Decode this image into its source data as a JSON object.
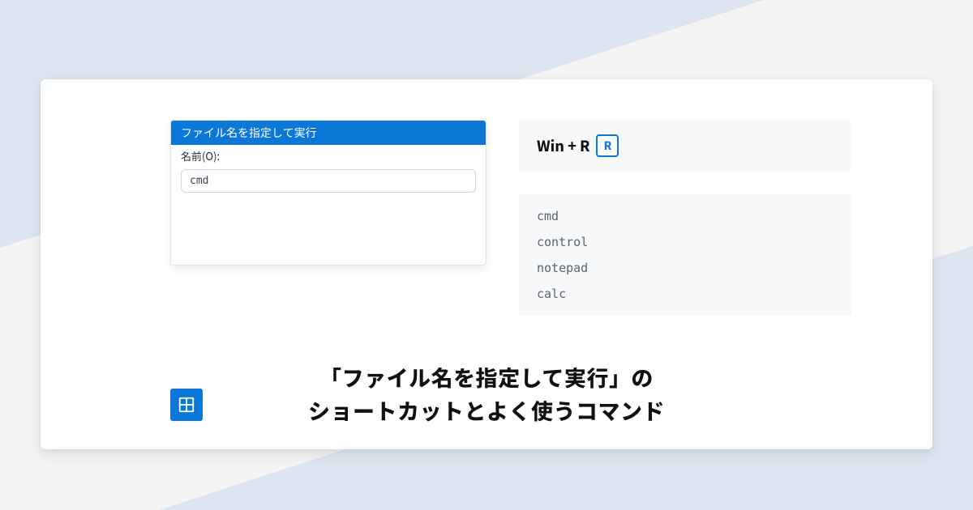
{
  "run_dialog": {
    "title": "ファイル名を指定して実行",
    "label": "名前(O):",
    "value": "cmd"
  },
  "shortcut": {
    "text": "Win + R",
    "key": "R"
  },
  "commands": [
    "cmd",
    "control",
    "notepad",
    "calc"
  ],
  "caption_line1": "「ファイル名を指定して実行」の",
  "caption_line2": "ショートカットとよく使うコマンド",
  "colors": {
    "accent": "#0b78d7"
  }
}
